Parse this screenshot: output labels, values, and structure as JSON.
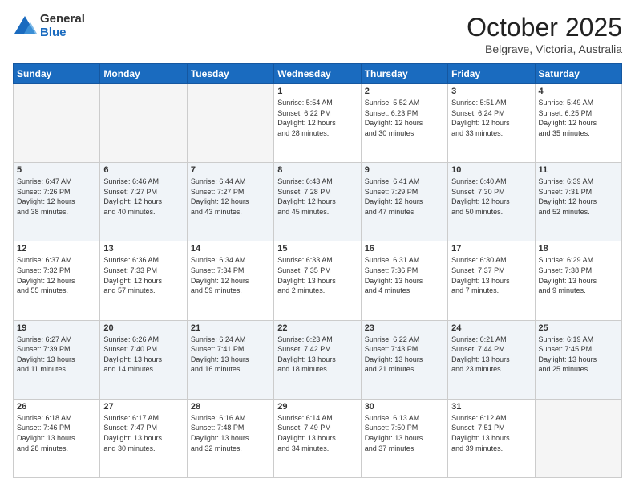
{
  "logo": {
    "general": "General",
    "blue": "Blue"
  },
  "header": {
    "month": "October 2025",
    "location": "Belgrave, Victoria, Australia"
  },
  "days": [
    "Sunday",
    "Monday",
    "Tuesday",
    "Wednesday",
    "Thursday",
    "Friday",
    "Saturday"
  ],
  "weeks": [
    [
      {
        "day": "",
        "lines": []
      },
      {
        "day": "",
        "lines": []
      },
      {
        "day": "",
        "lines": []
      },
      {
        "day": "1",
        "lines": [
          "Sunrise: 5:54 AM",
          "Sunset: 6:22 PM",
          "Daylight: 12 hours",
          "and 28 minutes."
        ]
      },
      {
        "day": "2",
        "lines": [
          "Sunrise: 5:52 AM",
          "Sunset: 6:23 PM",
          "Daylight: 12 hours",
          "and 30 minutes."
        ]
      },
      {
        "day": "3",
        "lines": [
          "Sunrise: 5:51 AM",
          "Sunset: 6:24 PM",
          "Daylight: 12 hours",
          "and 33 minutes."
        ]
      },
      {
        "day": "4",
        "lines": [
          "Sunrise: 5:49 AM",
          "Sunset: 6:25 PM",
          "Daylight: 12 hours",
          "and 35 minutes."
        ]
      }
    ],
    [
      {
        "day": "5",
        "lines": [
          "Sunrise: 6:47 AM",
          "Sunset: 7:26 PM",
          "Daylight: 12 hours",
          "and 38 minutes."
        ]
      },
      {
        "day": "6",
        "lines": [
          "Sunrise: 6:46 AM",
          "Sunset: 7:27 PM",
          "Daylight: 12 hours",
          "and 40 minutes."
        ]
      },
      {
        "day": "7",
        "lines": [
          "Sunrise: 6:44 AM",
          "Sunset: 7:27 PM",
          "Daylight: 12 hours",
          "and 43 minutes."
        ]
      },
      {
        "day": "8",
        "lines": [
          "Sunrise: 6:43 AM",
          "Sunset: 7:28 PM",
          "Daylight: 12 hours",
          "and 45 minutes."
        ]
      },
      {
        "day": "9",
        "lines": [
          "Sunrise: 6:41 AM",
          "Sunset: 7:29 PM",
          "Daylight: 12 hours",
          "and 47 minutes."
        ]
      },
      {
        "day": "10",
        "lines": [
          "Sunrise: 6:40 AM",
          "Sunset: 7:30 PM",
          "Daylight: 12 hours",
          "and 50 minutes."
        ]
      },
      {
        "day": "11",
        "lines": [
          "Sunrise: 6:39 AM",
          "Sunset: 7:31 PM",
          "Daylight: 12 hours",
          "and 52 minutes."
        ]
      }
    ],
    [
      {
        "day": "12",
        "lines": [
          "Sunrise: 6:37 AM",
          "Sunset: 7:32 PM",
          "Daylight: 12 hours",
          "and 55 minutes."
        ]
      },
      {
        "day": "13",
        "lines": [
          "Sunrise: 6:36 AM",
          "Sunset: 7:33 PM",
          "Daylight: 12 hours",
          "and 57 minutes."
        ]
      },
      {
        "day": "14",
        "lines": [
          "Sunrise: 6:34 AM",
          "Sunset: 7:34 PM",
          "Daylight: 12 hours",
          "and 59 minutes."
        ]
      },
      {
        "day": "15",
        "lines": [
          "Sunrise: 6:33 AM",
          "Sunset: 7:35 PM",
          "Daylight: 13 hours",
          "and 2 minutes."
        ]
      },
      {
        "day": "16",
        "lines": [
          "Sunrise: 6:31 AM",
          "Sunset: 7:36 PM",
          "Daylight: 13 hours",
          "and 4 minutes."
        ]
      },
      {
        "day": "17",
        "lines": [
          "Sunrise: 6:30 AM",
          "Sunset: 7:37 PM",
          "Daylight: 13 hours",
          "and 7 minutes."
        ]
      },
      {
        "day": "18",
        "lines": [
          "Sunrise: 6:29 AM",
          "Sunset: 7:38 PM",
          "Daylight: 13 hours",
          "and 9 minutes."
        ]
      }
    ],
    [
      {
        "day": "19",
        "lines": [
          "Sunrise: 6:27 AM",
          "Sunset: 7:39 PM",
          "Daylight: 13 hours",
          "and 11 minutes."
        ]
      },
      {
        "day": "20",
        "lines": [
          "Sunrise: 6:26 AM",
          "Sunset: 7:40 PM",
          "Daylight: 13 hours",
          "and 14 minutes."
        ]
      },
      {
        "day": "21",
        "lines": [
          "Sunrise: 6:24 AM",
          "Sunset: 7:41 PM",
          "Daylight: 13 hours",
          "and 16 minutes."
        ]
      },
      {
        "day": "22",
        "lines": [
          "Sunrise: 6:23 AM",
          "Sunset: 7:42 PM",
          "Daylight: 13 hours",
          "and 18 minutes."
        ]
      },
      {
        "day": "23",
        "lines": [
          "Sunrise: 6:22 AM",
          "Sunset: 7:43 PM",
          "Daylight: 13 hours",
          "and 21 minutes."
        ]
      },
      {
        "day": "24",
        "lines": [
          "Sunrise: 6:21 AM",
          "Sunset: 7:44 PM",
          "Daylight: 13 hours",
          "and 23 minutes."
        ]
      },
      {
        "day": "25",
        "lines": [
          "Sunrise: 6:19 AM",
          "Sunset: 7:45 PM",
          "Daylight: 13 hours",
          "and 25 minutes."
        ]
      }
    ],
    [
      {
        "day": "26",
        "lines": [
          "Sunrise: 6:18 AM",
          "Sunset: 7:46 PM",
          "Daylight: 13 hours",
          "and 28 minutes."
        ]
      },
      {
        "day": "27",
        "lines": [
          "Sunrise: 6:17 AM",
          "Sunset: 7:47 PM",
          "Daylight: 13 hours",
          "and 30 minutes."
        ]
      },
      {
        "day": "28",
        "lines": [
          "Sunrise: 6:16 AM",
          "Sunset: 7:48 PM",
          "Daylight: 13 hours",
          "and 32 minutes."
        ]
      },
      {
        "day": "29",
        "lines": [
          "Sunrise: 6:14 AM",
          "Sunset: 7:49 PM",
          "Daylight: 13 hours",
          "and 34 minutes."
        ]
      },
      {
        "day": "30",
        "lines": [
          "Sunrise: 6:13 AM",
          "Sunset: 7:50 PM",
          "Daylight: 13 hours",
          "and 37 minutes."
        ]
      },
      {
        "day": "31",
        "lines": [
          "Sunrise: 6:12 AM",
          "Sunset: 7:51 PM",
          "Daylight: 13 hours",
          "and 39 minutes."
        ]
      },
      {
        "day": "",
        "lines": []
      }
    ]
  ]
}
